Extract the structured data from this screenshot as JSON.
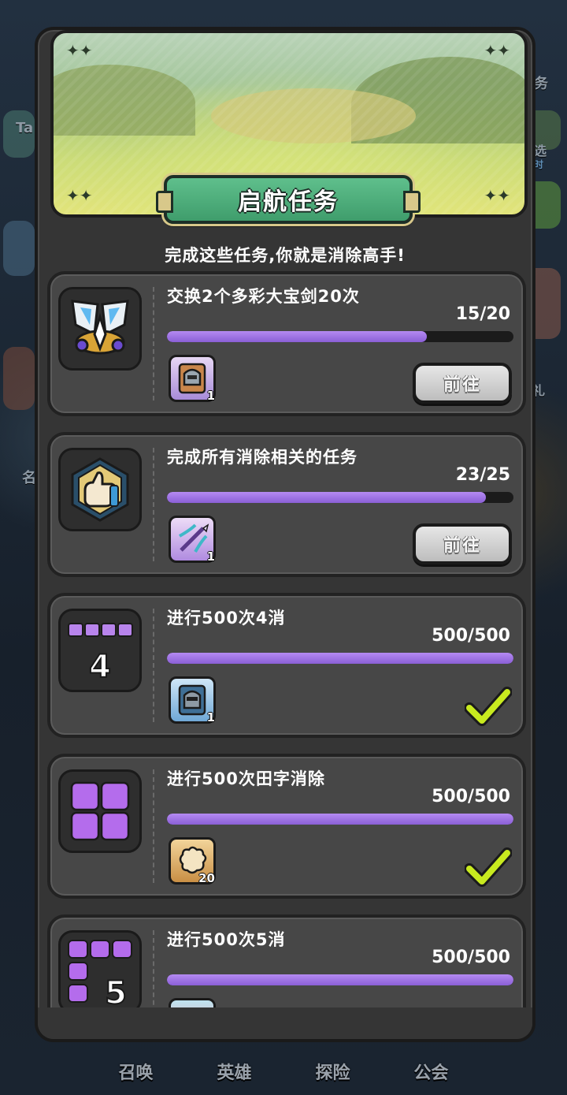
{
  "title": "启航任务",
  "subtitle": "完成这些任务,你就是消除高手!",
  "colors": {
    "accent_purple": "#9b6fe4",
    "title_green": "#4fae7c",
    "check_green": "#c8ea1f",
    "panel": "#353535",
    "card": "#474747"
  },
  "tasks": [
    {
      "title": "交换2个多彩大宝剑20次",
      "progress": "15/20",
      "progress_fraction": 0.75,
      "icon": "sword-badge-icon",
      "reward_icon": "helmet-card-icon",
      "reward_qty": "1",
      "action": "前往",
      "completed": false
    },
    {
      "title": "完成所有消除相关的任务",
      "progress": "23/25",
      "progress_fraction": 0.92,
      "icon": "thumbs-up-badge-icon",
      "reward_icon": "crossbow-card-icon",
      "reward_qty": "1",
      "action": "前往",
      "completed": false
    },
    {
      "title": "进行500次4消",
      "progress": "500/500",
      "progress_fraction": 1.0,
      "icon": "four-match-icon",
      "icon_label": "4",
      "reward_icon": "knight-helmet-card-icon",
      "reward_qty": "1",
      "completed": true
    },
    {
      "title": "进行500次田字消除",
      "progress": "500/500",
      "progress_fraction": 1.0,
      "icon": "square-match-icon",
      "reward_icon": "puzzle-piece-card-icon",
      "reward_qty": "20",
      "completed": true
    },
    {
      "title": "进行500次5消",
      "progress": "500/500",
      "progress_fraction": 1.0,
      "icon": "five-match-icon",
      "icon_label": "5",
      "reward_icon": "pink-card-icon",
      "completed": true
    }
  ],
  "background": {
    "left_labels": [
      "Ta",
      "名"
    ],
    "right_labels": [
      "任务",
      "爆选",
      "小时",
      "礼"
    ],
    "bottom_nav": [
      "召唤",
      "英雄",
      "探险",
      "公会"
    ]
  }
}
